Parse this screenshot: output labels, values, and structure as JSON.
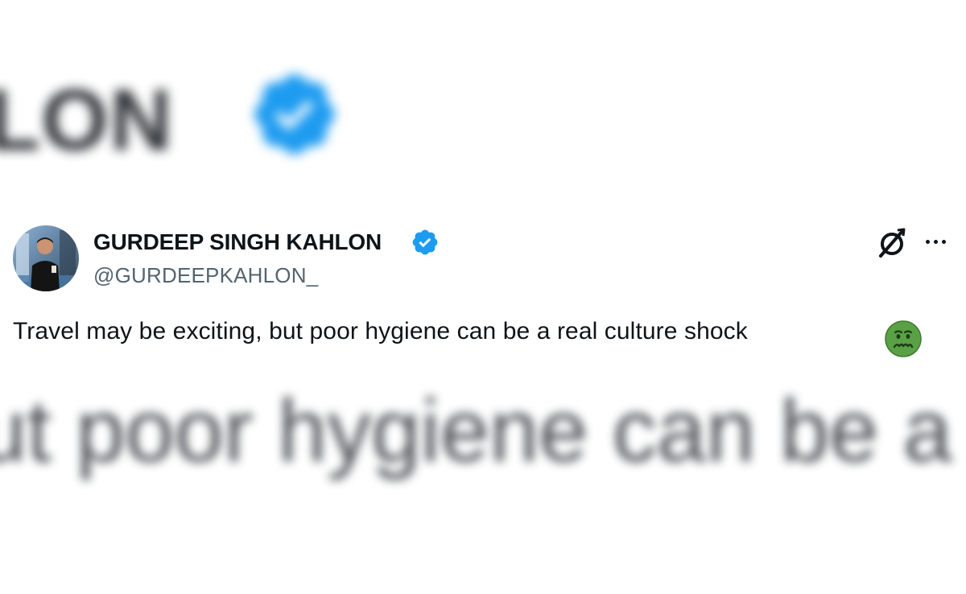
{
  "background": {
    "top_blur_text": "HLON",
    "bottom_blur_text": "ut poor hygiene can be a"
  },
  "tweet": {
    "display_name": "GURDEEP SINGH KAHLON",
    "handle": "@GURDEEPKAHLON_",
    "text": "Travel may be exciting, but poor hygiene can be a real culture shock",
    "emoji": "nauseated-face",
    "verified": true
  },
  "icons": {
    "verified": "verified-badge-icon",
    "platform": "x-logo-icon",
    "more": "more-options-icon",
    "emoji": "nauseated-face-emoji"
  },
  "colors": {
    "verified_blue": "#1d9bf0",
    "text_primary": "#0f1419",
    "text_secondary": "#536471",
    "emoji_green": "#5aa146"
  }
}
